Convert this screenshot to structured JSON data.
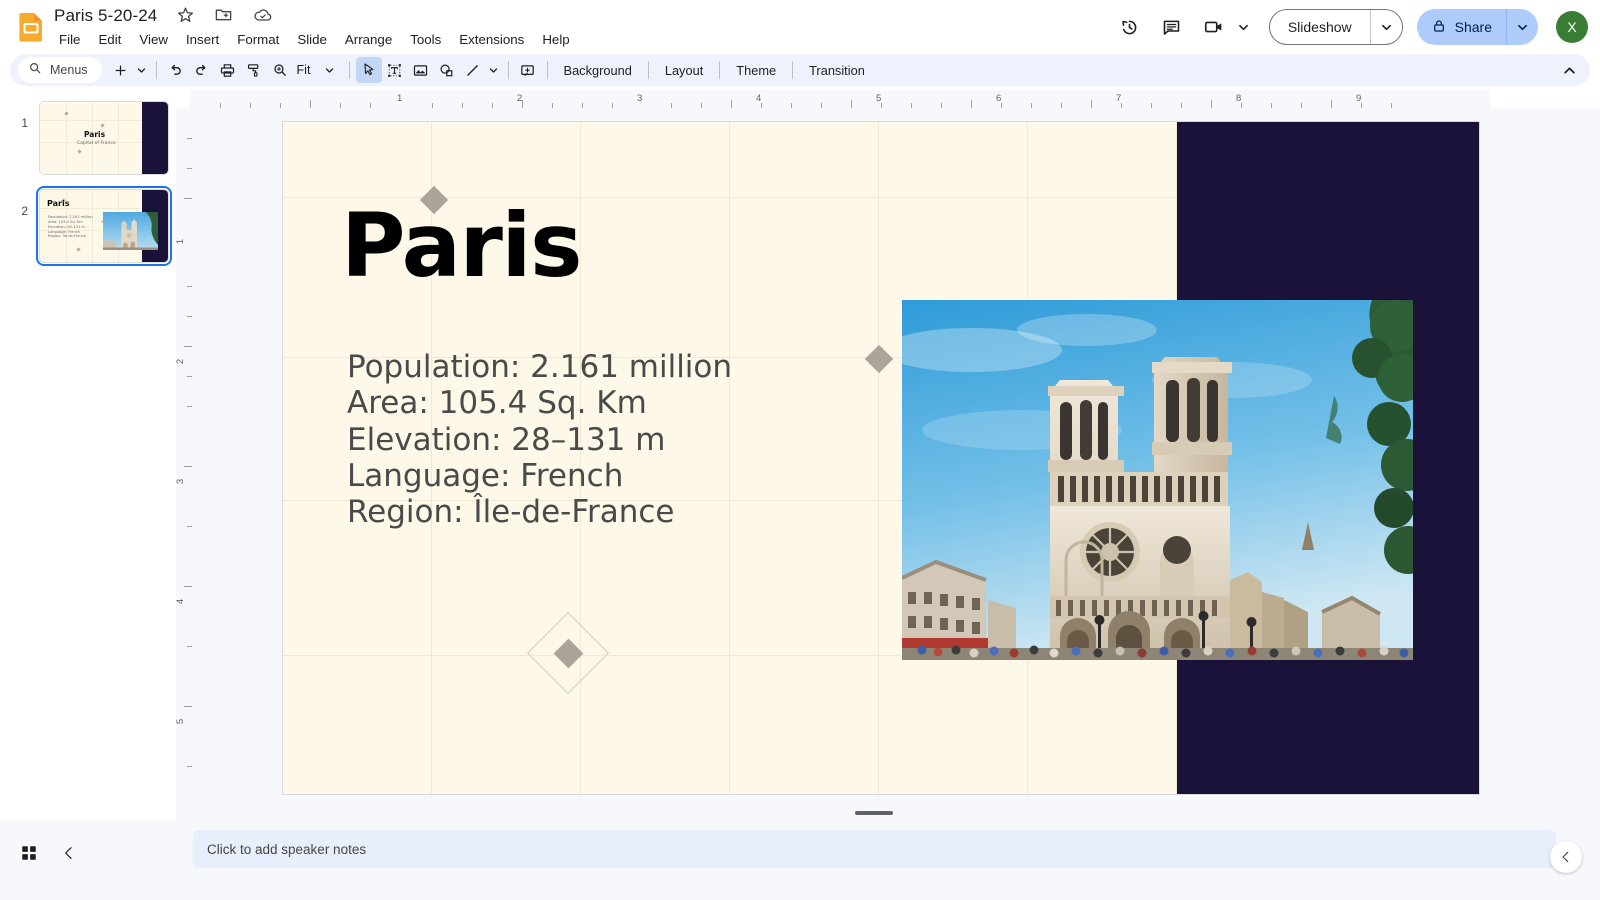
{
  "app": {
    "logo_icon": "slides-logo-icon",
    "doc_title": "Paris 5-20-24",
    "title_icons": [
      "star-icon",
      "move-to-folder-icon",
      "cloud-saved-icon"
    ]
  },
  "menubar": {
    "items": [
      "File",
      "Edit",
      "View",
      "Insert",
      "Format",
      "Slide",
      "Arrange",
      "Tools",
      "Extensions",
      "Help"
    ]
  },
  "top_right": {
    "history_icon": "version-history-icon",
    "comment_icon": "comment-icon",
    "meet_icon": "meet-camera-icon",
    "meet_caret_icon": "chevron-down-icon",
    "slideshow_label": "Slideshow",
    "slideshow_caret_icon": "chevron-down-icon",
    "share_label": "Share",
    "share_lock_icon": "lock-icon",
    "share_caret_icon": "chevron-down-icon",
    "avatar_initial": "X",
    "avatar_color": "#3a7d34",
    "share_bg": "#aecbfa"
  },
  "toolbar": {
    "search_icon": "search-icon",
    "menus_label": "Menus",
    "new_slide_icon": "plus-icon",
    "new_slide_caret_icon": "chevron-down-icon",
    "undo_icon": "undo-icon",
    "redo_icon": "redo-icon",
    "print_icon": "print-icon",
    "paint_format_icon": "paint-format-icon",
    "zoom_icon": "zoom-icon",
    "zoom_value": "Fit",
    "zoom_caret_icon": "chevron-down-icon",
    "select_icon": "select-arrow-icon",
    "textbox_icon": "text-box-icon",
    "image_icon": "insert-image-icon",
    "shape_icon": "shape-icon",
    "line_icon": "line-icon",
    "line_caret_icon": "chevron-down-icon",
    "comment_add_icon": "add-comment-icon",
    "background_label": "Background",
    "layout_label": "Layout",
    "theme_label": "Theme",
    "transition_label": "Transition",
    "collapse_icon": "chevron-up-icon"
  },
  "filmstrip": {
    "slides": [
      {
        "number": "1",
        "title": "Paris",
        "subtitle": "Capital of France",
        "selected": false
      },
      {
        "number": "2",
        "title": "Paris",
        "subtitle": "Population: 2.161 million\nArea: 105.4 Sq. Km\nElevation: 28–131 m\nLanguage: French\nRegion: Île-de-France",
        "selected": true
      }
    ]
  },
  "rulers": {
    "horizontal_labels": [
      "1",
      "2",
      "3",
      "4",
      "5",
      "6",
      "7",
      "8",
      "9"
    ],
    "vertical_labels": [
      "1",
      "2",
      "3",
      "4",
      "5"
    ]
  },
  "slide": {
    "title": "Paris",
    "body": "Population: 2.161 million\nArea: 105.4 Sq. Km\nElevation: 28–131 m\nLanguage: French\nRegion: Île-de-France",
    "background_color": "#fdf8e8",
    "panel_color": "#1a1238",
    "accent_diamond_color": "#aaa499",
    "photo_alt": "notre-dame-cathedral-photo"
  },
  "bottom": {
    "grid_view_icon": "grid-view-icon",
    "collapse_filmstrip_icon": "chevron-left-icon",
    "notes_placeholder": "Click to add speaker notes",
    "notes_collapse_icon": "chevron-left-icon"
  }
}
